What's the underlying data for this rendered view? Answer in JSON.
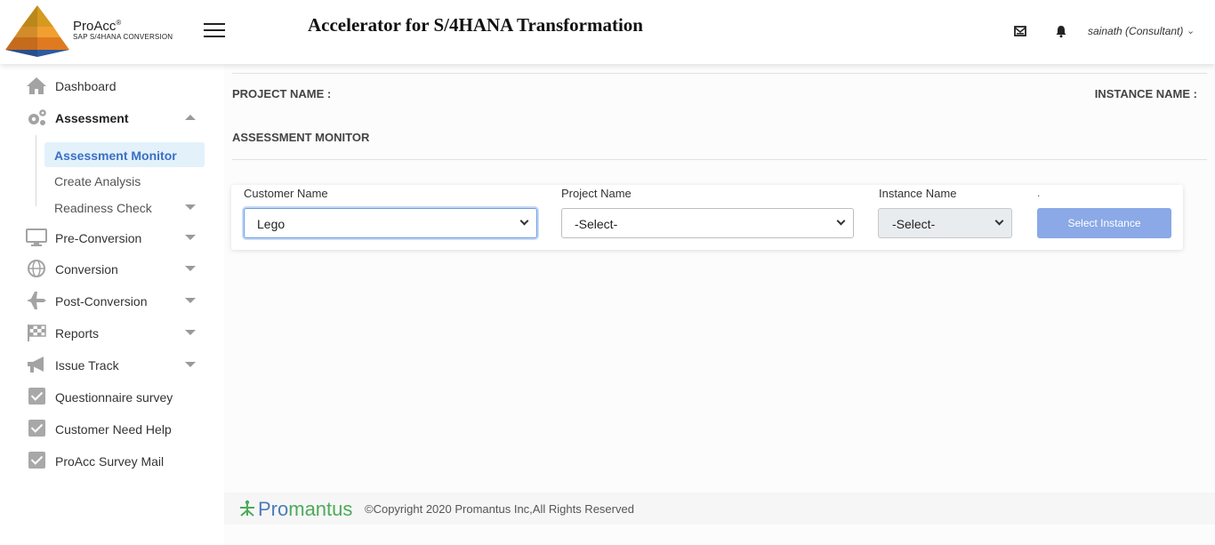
{
  "header": {
    "brand_name": "ProAcc",
    "brand_mark": "®",
    "brand_sub": "SAP S/4HANA CONVERSION",
    "app_title": "Accelerator for S/4HANA Transformation",
    "user_label": "sainath (Consultant)",
    "icons": {
      "mail": "mail-icon",
      "bell": "bell-icon",
      "menu": "hamburger-menu-icon"
    }
  },
  "sidebar": {
    "items": [
      {
        "label": "Dashboard",
        "icon": "home-icon"
      },
      {
        "label": "Assessment",
        "icon": "gears-icon",
        "expanded": true
      },
      {
        "label": "Pre-Conversion",
        "icon": "monitor-icon"
      },
      {
        "label": "Conversion",
        "icon": "globe-icon"
      },
      {
        "label": "Post-Conversion",
        "icon": "plane-icon"
      },
      {
        "label": "Reports",
        "icon": "checkered-flag-icon"
      },
      {
        "label": "Issue Track",
        "icon": "megaphone-icon"
      },
      {
        "label": "Questionnaire survey",
        "icon": "checkbox-icon"
      },
      {
        "label": "Customer Need Help",
        "icon": "checkbox-icon"
      },
      {
        "label": "ProAcc Survey Mail",
        "icon": "checkbox-icon"
      }
    ],
    "assessment_sub": [
      {
        "label": "Assessment Monitor",
        "active": true
      },
      {
        "label": "Create Analysis"
      },
      {
        "label": "Readiness Check"
      }
    ]
  },
  "main": {
    "project_name_label": "PROJECT NAME :",
    "instance_name_label": "INSTANCE NAME :",
    "section_title": "ASSESSMENT MONITOR",
    "form": {
      "customer_label": "Customer Name",
      "customer_value": "Lego",
      "project_label": "Project Name",
      "project_value": "-Select-",
      "instance_label": "Instance Name",
      "instance_value": "-Select-",
      "button_caption": ".",
      "button_label": "Select Instance"
    }
  },
  "footer": {
    "logo_text_a": "Pro",
    "logo_text_b": "mantus",
    "copyright": "©Copyright 2020 Promantus Inc,All Rights Reserved"
  },
  "colors": {
    "accent": "#3b6fc4",
    "button": "#8aa9e6",
    "active_bg": "#e3f1fb"
  }
}
